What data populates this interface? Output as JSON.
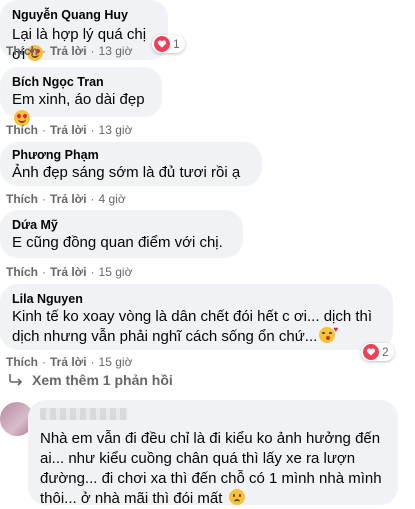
{
  "comments": [
    {
      "author": "Nguyễn Quang Huy",
      "text": "Lại là hợp lý quá chị ơi",
      "emoji": "heart-eyes-emoji",
      "like": "Thích",
      "reply": "Trả lời",
      "time": "13 giờ",
      "reaction_count": "1"
    },
    {
      "author": "Bích Ngọc Tran",
      "text": "Em xinh, áo dài đẹp",
      "emoji": "heart-eyes-emoji",
      "like": "Thích",
      "reply": "Trả lời",
      "time": "13 giờ"
    },
    {
      "author": "Phương Phạm",
      "text": "Ảnh đẹp sáng sớm là đủ tươi rồi ạ",
      "like": "Thích",
      "reply": "Trả lời",
      "time": "4 giờ"
    },
    {
      "author": "Dứa Mỹ",
      "text": "E cũng đồng quan điểm với chị.",
      "like": "Thích",
      "reply": "Trả lời",
      "time": "15 giờ"
    },
    {
      "author": "Lila Nguyen",
      "text_line1": "Kinh tế ko xoay vòng là dân chết đói hết c ơi... dịch thì",
      "text_line2": "dịch nhưng vẫn phải nghĩ cách sống ổn chứ...",
      "emoji": "kissing-heart-emoji",
      "like": "Thích",
      "reply": "Trả lời",
      "time": "15 giờ",
      "reaction_count": "2"
    }
  ],
  "see_more": "Xem thêm 1 phản hồi",
  "reply_comment": {
    "line1": "Nhà em vẫn đi đều chỉ là đi kiểu ko ảnh hưởng đến",
    "line2": "ai... như kiểu cuồng chân quá thì lấy xe ra lượn",
    "line3": "đường... đi chơi xa thì đến chỗ có 1 mình nhà mình",
    "line4": "thôi... ở nhà mãi thì đói mất",
    "emoji": "worried-face-emoji"
  },
  "colors": {
    "bubble": "#f0f2f5",
    "meta": "#65676b",
    "heart": "#f33e58"
  }
}
